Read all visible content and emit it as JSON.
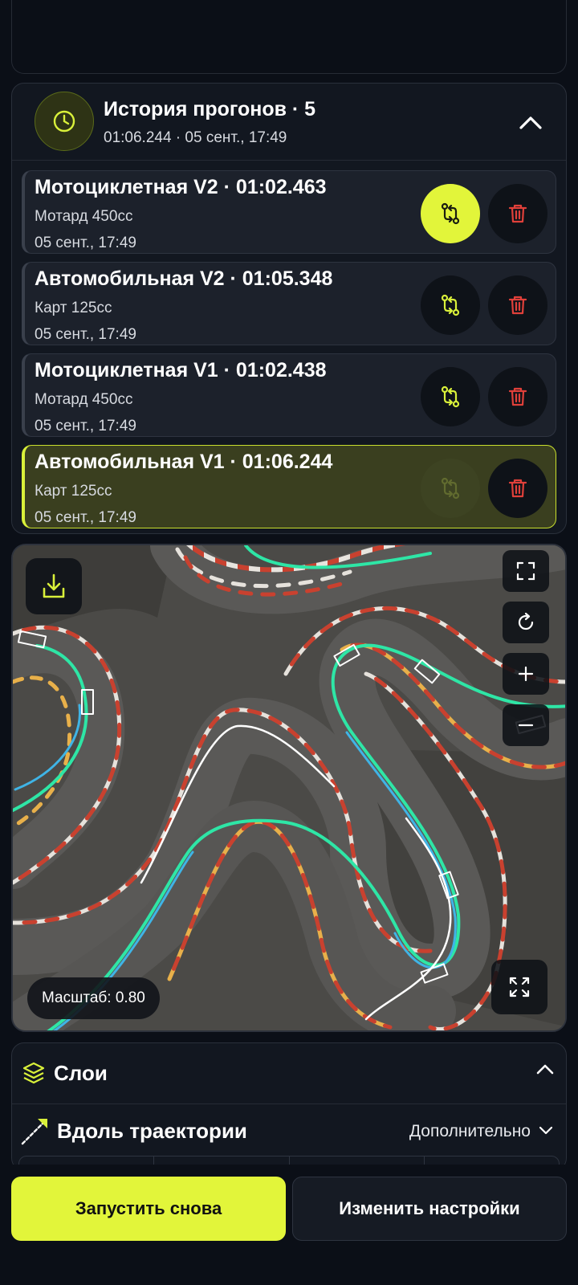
{
  "history": {
    "title": "История прогонов · 5",
    "subtitle": "01:06.244 · 05 сент., 17:49",
    "runs": [
      {
        "title": "Мотоциклетная V2 · 01:02.463",
        "vehicle": "Мотард 450cc",
        "date": "05 сент., 17:49"
      },
      {
        "title": "Автомобильная V2 · 01:05.348",
        "vehicle": "Карт 125cc",
        "date": "05 сент., 17:49"
      },
      {
        "title": "Мотоциклетная V1 · 01:02.438",
        "vehicle": "Мотард 450cc",
        "date": "05 сент., 17:49"
      },
      {
        "title": "Автомобильная V1 · 01:06.244",
        "vehicle": "Карт 125cc",
        "date": "05 сент., 17:49"
      }
    ]
  },
  "map": {
    "scale_label": "Масштаб: 0.80"
  },
  "layers": {
    "title": "Слои",
    "trajectory_label": "Вдоль траектории",
    "extra_label": "Дополнительно"
  },
  "actions": {
    "run_again": "Запустить снова",
    "change_settings": "Изменить настройки"
  },
  "colors": {
    "accent": "#e2f53a",
    "delete": "#e0403a",
    "trajectory": "#2ee6a6",
    "background": "#0b0f17"
  },
  "icons": [
    "clock-icon",
    "chevron-up-icon",
    "compare-icon",
    "trash-icon",
    "download-icon",
    "fullscreen-icon",
    "reset-icon",
    "zoom-in-icon",
    "zoom-out-icon",
    "fit-icon",
    "layers-icon",
    "trajectory-icon",
    "chevron-down-icon"
  ]
}
